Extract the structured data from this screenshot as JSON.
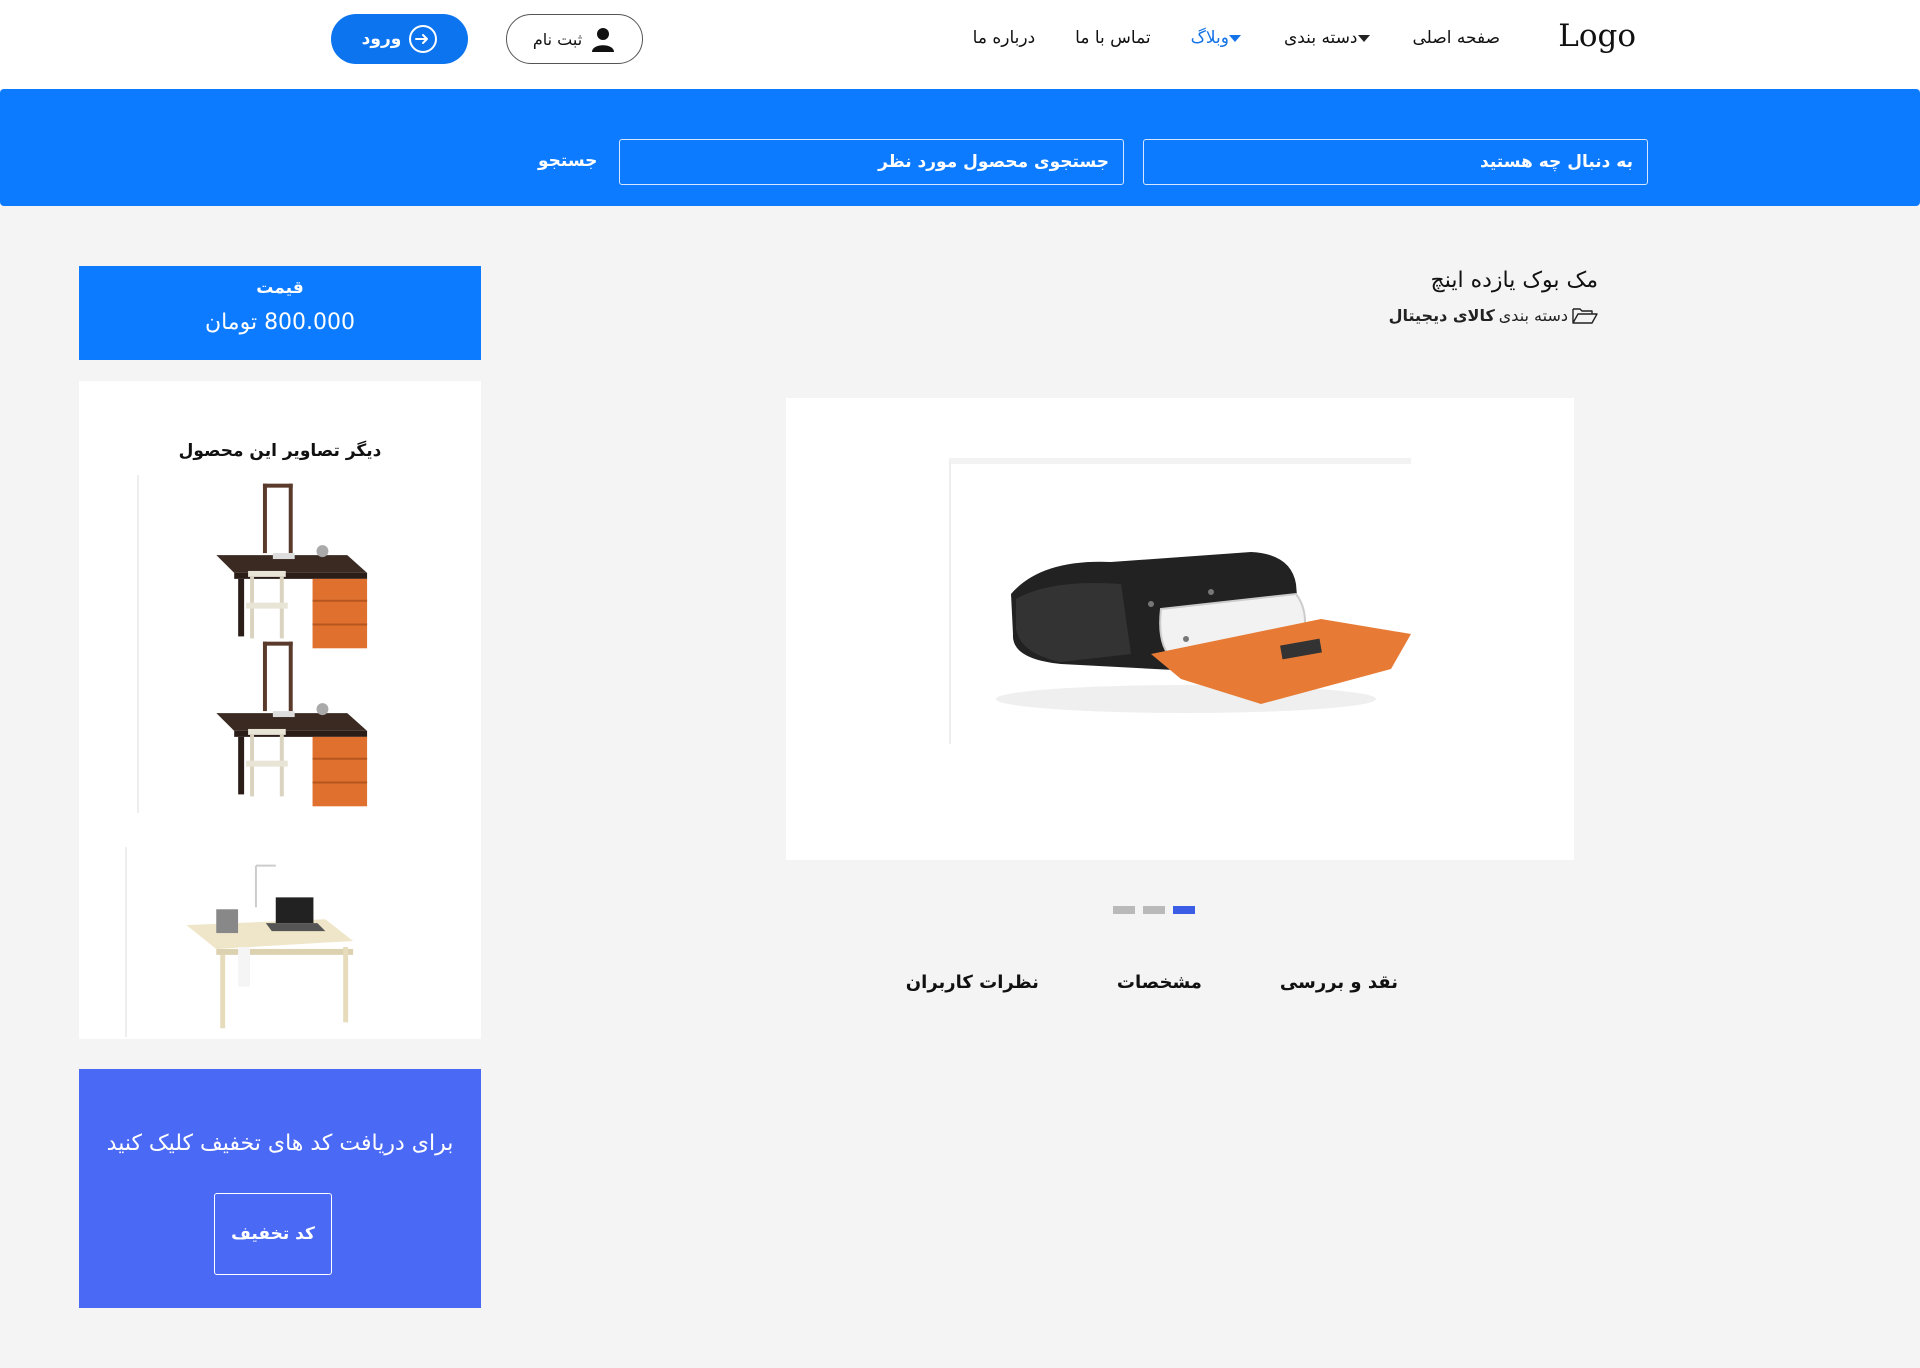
{
  "header": {
    "logo": "Logo",
    "nav": [
      {
        "label": "صفحه اصلی",
        "dropdown": false,
        "active": false
      },
      {
        "label": "دسته بندی",
        "dropdown": true,
        "active": false
      },
      {
        "label": "وبلاگ",
        "dropdown": true,
        "active": true
      },
      {
        "label": "تماس با ما",
        "dropdown": false,
        "active": false
      },
      {
        "label": "درباره ما",
        "dropdown": false,
        "active": false
      }
    ],
    "register_label": "ثبت نام",
    "login_label": "ورود"
  },
  "search": {
    "what_placeholder": "به دنبال چه هستید",
    "product_placeholder": "جستجوی محصول مورد نظر",
    "button_label": "جستجو"
  },
  "product": {
    "title": "مک بوک یازده اینچ",
    "category_prefix": "دسته بندی",
    "category_name": "کالای دیجیتال",
    "slides_count": 3,
    "active_slide": 3
  },
  "price": {
    "label": "قیمت",
    "value": "800.000 تومان"
  },
  "gallery": {
    "title": "دیگر تصاویر این محصول",
    "images": [
      "desk-with-chair-and-drawers",
      "desk-with-chair-and-drawers",
      "desk-with-laptop"
    ]
  },
  "promo": {
    "text": "برای دریافت کد های تخفیف کلیک کنید",
    "button_label": "کد تخفیف"
  },
  "tabs": [
    {
      "label": "نقد و بررسی"
    },
    {
      "label": "مشخصات"
    },
    {
      "label": "نظرات کاربران"
    }
  ],
  "colors": {
    "primary_blue": "#0d7bff",
    "promo_blue": "#4a69f5",
    "active_nav": "#1473e6",
    "page_bg": "#f4f4f4"
  }
}
